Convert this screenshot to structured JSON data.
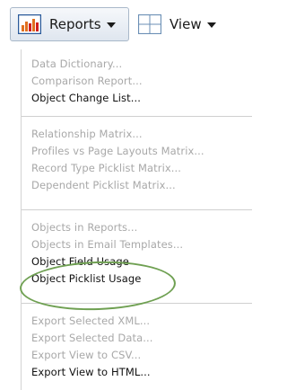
{
  "toolbar": {
    "reports_label": "Reports",
    "view_label": "View",
    "reports_icon": "bar-chart-icon",
    "view_icon": "grid-layout-icon"
  },
  "menu": {
    "groups": [
      [
        {
          "label": "Data Dictionary...",
          "enabled": false
        },
        {
          "label": "Comparison Report...",
          "enabled": false
        },
        {
          "label": "Object Change List...",
          "enabled": true
        }
      ],
      [
        {
          "label": "Relationship Matrix...",
          "enabled": false
        },
        {
          "label": "Profiles vs Page Layouts Matrix...",
          "enabled": false
        },
        {
          "label": "Record Type Picklist Matrix...",
          "enabled": false
        },
        {
          "label": "Dependent Picklist Matrix...",
          "enabled": false
        }
      ],
      [
        {
          "label": "Objects in Reports...",
          "enabled": false
        },
        {
          "label": "Objects in Email Templates...",
          "enabled": false
        },
        {
          "label": "Object Field Usage",
          "enabled": true
        },
        {
          "label": "Object Picklist Usage",
          "enabled": true
        }
      ],
      [
        {
          "label": "Export Selected XML...",
          "enabled": false
        },
        {
          "label": "Export Selected Data...",
          "enabled": false
        },
        {
          "label": "Export View to CSV...",
          "enabled": false
        },
        {
          "label": "Export View to HTML...",
          "enabled": true
        }
      ]
    ]
  },
  "colors": {
    "disabled_text": "#a8a8a8",
    "enabled_text": "#111111",
    "highlight_ellipse": "#6fa052",
    "button_border": "#a9b8c9"
  }
}
